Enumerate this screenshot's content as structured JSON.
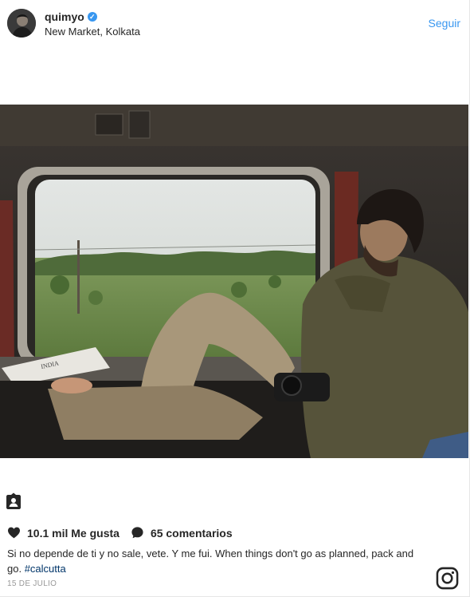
{
  "post": {
    "username": "quimyo",
    "verified_mark": "✓",
    "location": "New Market, Kolkata",
    "follow_label": "Seguir",
    "likes": "10.1 mil Me gusta",
    "comments": "65 comentarios",
    "caption_text": "Si no depende de ti y no sale, vete. Y me fui. When things don't go as planned, pack and go. ",
    "hashtag": "#calcutta",
    "date": "15 DE JULIO",
    "newspaper_text": "INDIA"
  },
  "icons": {
    "avatar": "profile-photo",
    "verified": "verified-badge-icon",
    "tag": "user-tag-icon",
    "heart": "heart-icon",
    "comment": "comment-bubble-icon",
    "instagram": "instagram-logo-icon"
  },
  "colors": {
    "link": "#3897f0",
    "hashtag": "#003569",
    "verified": "#3897f0",
    "muted": "#999999"
  }
}
